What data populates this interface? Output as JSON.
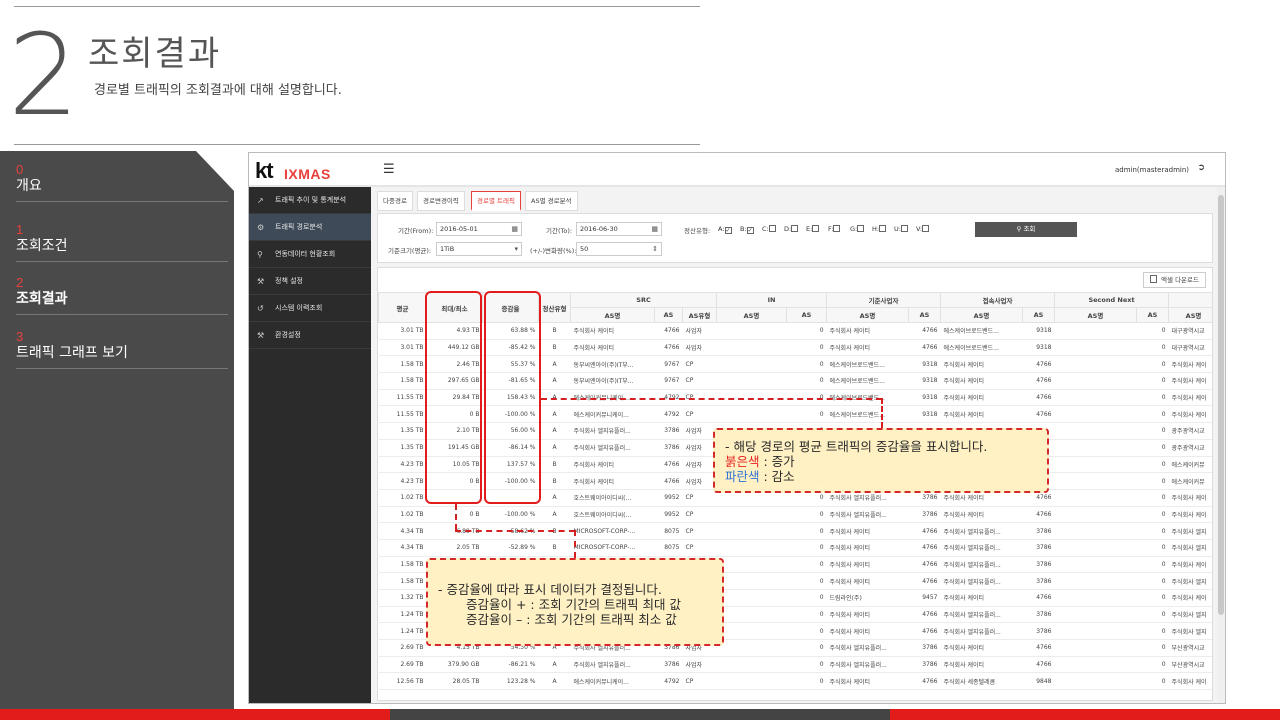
{
  "slide": {
    "number": "2",
    "title": "조회결과",
    "subtitle": "경로별 트래픽의 조회결과에 대해 설명합니다."
  },
  "left_menu": [
    {
      "num": "0",
      "label": "개요"
    },
    {
      "num": "1",
      "label": "조회조건"
    },
    {
      "num": "2",
      "label": "조회결과"
    },
    {
      "num": "3",
      "label": "트래픽 그래프 보기"
    }
  ],
  "colors": {
    "accent": "#e8413c",
    "menu_bg": "#4a4a4a",
    "bottom_dark": "#444444"
  },
  "app": {
    "logo_kt": "kt",
    "logo_brand": "IXMAS",
    "user": "admin(masteradmin)",
    "side_menu": [
      {
        "icon": "chart-line-icon",
        "label": "트래픽 추이 및 통계분석"
      },
      {
        "icon": "gauge-icon",
        "label": "트래픽 경로분석"
      },
      {
        "icon": "search-icon",
        "label": "연동데이터 현황조회"
      },
      {
        "icon": "wrench-icon",
        "label": "정책 설정"
      },
      {
        "icon": "history-icon",
        "label": "시스템 이력조회"
      },
      {
        "icon": "wrench-icon",
        "label": "환경설정"
      }
    ],
    "tabs": [
      "다중경로",
      "경로변경이력",
      "경로별 트래픽",
      "AS별 경로분석"
    ],
    "filters": {
      "from_label": "기간(From):",
      "from_value": "2016-05-01",
      "to_label": "기간(To):",
      "to_value": "2016-06-30",
      "type_label": "정산유형:",
      "types": [
        {
          "label": "A:",
          "checked": true
        },
        {
          "label": "B:",
          "checked": true
        },
        {
          "label": "C:",
          "checked": false
        },
        {
          "label": "D:",
          "checked": false
        },
        {
          "label": "E:",
          "checked": false
        },
        {
          "label": "F:",
          "checked": false
        },
        {
          "label": "G:",
          "checked": false
        },
        {
          "label": "H:",
          "checked": false
        },
        {
          "label": "U:",
          "checked": false
        },
        {
          "label": "V:",
          "checked": false
        }
      ],
      "search_label": "조회",
      "size_label": "기준크기(평균):",
      "size_value": "1TiB",
      "change_label": "(+/-)변화량(%):",
      "change_value": "50"
    },
    "excel_label": "엑셀 다운로드",
    "table": {
      "group_headers": [
        "평균",
        "최대/최소",
        "증감율",
        "정산유형",
        "SRC",
        "IN",
        "기준사업자",
        "접속사업자",
        "Second Next",
        ""
      ],
      "sub_headers": [
        "AS명",
        "AS",
        "AS유형",
        "AS명",
        "AS",
        "AS명",
        "AS",
        "AS명",
        "AS",
        "AS명",
        "AS",
        "AS명"
      ],
      "rows": [
        [
          "3.01 TB",
          "4.93 TB",
          "63.88 %",
          "B",
          "주식회사 케이티",
          "4766",
          "사업자",
          "",
          "0",
          "주식회사 케이티",
          "4766",
          "에스케이브로드밴드...",
          "9318",
          "",
          "0",
          "대구광역시교"
        ],
        [
          "3.01 TB",
          "449.12 GB",
          "-85.42 %",
          "B",
          "주식회사 케이티",
          "4766",
          "사업자",
          "",
          "0",
          "주식회사 케이티",
          "4766",
          "에스케이브로드밴드...",
          "9318",
          "",
          "0",
          "대구광역시교"
        ],
        [
          "1.58 TB",
          "2.46 TB",
          "55.37 %",
          "A",
          "동부씨엔아이(주)IT부...",
          "9767",
          "CP",
          "",
          "0",
          "에스케이브로드밴드...",
          "9318",
          "주식회사 케이티",
          "4766",
          "",
          "0",
          "주식회사 케이"
        ],
        [
          "1.58 TB",
          "297.65 GB",
          "-81.65 %",
          "A",
          "동부씨엔아이(주)IT부...",
          "9767",
          "CP",
          "",
          "0",
          "에스케이브로드밴드...",
          "9318",
          "주식회사 케이티",
          "4766",
          "",
          "0",
          "주식회사 케이"
        ],
        [
          "11.55 TB",
          "29.84 TB",
          "158.43 %",
          "A",
          "에스케이커뮤니케이...",
          "4792",
          "CP",
          "",
          "0",
          "에스케이브로드밴드...",
          "9318",
          "주식회사 케이티",
          "4766",
          "",
          "0",
          "주식회사 케이"
        ],
        [
          "11.55 TB",
          "0 B",
          "-100.00 %",
          "A",
          "에스케이커뮤니케이...",
          "4792",
          "CP",
          "",
          "0",
          "에스케이브로드밴드...",
          "9318",
          "주식회사 케이티",
          "4766",
          "",
          "0",
          "주식회사 케이"
        ],
        [
          "1.35 TB",
          "2.10 TB",
          "56.00 %",
          "A",
          "주식회사 엘지유플러...",
          "3786",
          "사업자",
          "",
          "0",
          "",
          "",
          "",
          "",
          "",
          "0",
          "광주광역시교"
        ],
        [
          "1.35 TB",
          "191.45 GB",
          "-86.14 %",
          "A",
          "주식회사 엘지유플러...",
          "3786",
          "사업자",
          "",
          "0",
          "",
          "",
          "",
          "",
          "",
          "0",
          "광주광역시교"
        ],
        [
          "4.23 TB",
          "10.05 TB",
          "137.57 %",
          "B",
          "주식회사 케이티",
          "4766",
          "사업자",
          "",
          "0",
          "",
          "",
          "",
          "",
          "",
          "0",
          "에스케이커뮤"
        ],
        [
          "4.23 TB",
          "0 B",
          "-100.00 %",
          "B",
          "주식회사 케이티",
          "4766",
          "사업자",
          "",
          "0",
          "",
          "",
          "",
          "",
          "",
          "0",
          "에스케이커뮤"
        ],
        [
          "1.02 TB",
          "",
          "",
          "A",
          "호스트웨이아이디씨(...",
          "9952",
          "CP",
          "",
          "0",
          "주식회사 엘지유플러...",
          "3786",
          "주식회사 케이티",
          "4766",
          "",
          "0",
          "주식회사 케이"
        ],
        [
          "1.02 TB",
          "0 B",
          "-100.00 %",
          "A",
          "호스트웨이아이디씨(...",
          "9952",
          "CP",
          "",
          "0",
          "주식회사 엘지유플러...",
          "3786",
          "주식회사 케이티",
          "4766",
          "",
          "0",
          "주식회사 케이"
        ],
        [
          "4.34 TB",
          "6.89 TB",
          "58.62 %",
          "B",
          "MICROSOFT-CORP-...",
          "8075",
          "CP",
          "",
          "0",
          "주식회사 케이티",
          "4766",
          "주식회사 엘지유플러...",
          "3786",
          "",
          "0",
          "주식회사 엘지"
        ],
        [
          "4.34 TB",
          "2.05 TB",
          "-52.89 %",
          "B",
          "MICROSOFT-CORP-...",
          "8075",
          "CP",
          "",
          "0",
          "주식회사 케이티",
          "4766",
          "주식회사 엘지유플러...",
          "3786",
          "",
          "0",
          "주식회사 엘지"
        ],
        [
          "1.58 TB",
          "",
          "",
          "",
          "",
          "",
          "",
          "",
          "0",
          "주식회사 케이티",
          "4766",
          "주식회사 엘지유플러...",
          "3786",
          "",
          "0",
          "주식회사 케이"
        ],
        [
          "1.58 TB",
          "",
          "",
          "",
          "",
          "",
          "",
          "",
          "0",
          "주식회사 케이티",
          "4766",
          "주식회사 엘지유플러...",
          "3786",
          "",
          "0",
          "주식회사 엘지"
        ],
        [
          "1.32 TB",
          "",
          "",
          "",
          "",
          "",
          "",
          "",
          "0",
          "드림라인(주)",
          "9457",
          "주식회사 케이티",
          "4766",
          "",
          "0",
          "주식회사 케이"
        ],
        [
          "1.24 TB",
          "",
          "",
          "",
          "",
          "",
          "",
          "",
          "0",
          "주식회사 케이티",
          "4766",
          "주식회사 엘지유플러...",
          "3786",
          "",
          "0",
          "주식회사 엘지"
        ],
        [
          "1.24 TB",
          "",
          "",
          "",
          "",
          "",
          "",
          "",
          "0",
          "주식회사 케이티",
          "4766",
          "주식회사 엘지유플러...",
          "3786",
          "",
          "0",
          "주식회사 엘지"
        ],
        [
          "2.69 TB",
          "4.15 TB",
          "54.30 %",
          "A",
          "주식회사 엘지유플러...",
          "3786",
          "사업자",
          "",
          "0",
          "주식회사 엘지유플러...",
          "3786",
          "주식회사 케이티",
          "4766",
          "",
          "0",
          "부산광역시교"
        ],
        [
          "2.69 TB",
          "379.90 GB",
          "-86.21 %",
          "A",
          "주식회사 엘지유플러...",
          "3786",
          "사업자",
          "",
          "0",
          "주식회사 엘지유플러...",
          "3786",
          "주식회사 케이티",
          "4766",
          "",
          "0",
          "부산광역시교"
        ],
        [
          "12.56 TB",
          "28.05 TB",
          "123.28 %",
          "A",
          "에스케이커뮤니케이...",
          "4792",
          "CP",
          "",
          "0",
          "주식회사 케이티",
          "4766",
          "주식회사 세종텔레콤",
          "9848",
          "",
          "0",
          "주식회사 케이"
        ]
      ]
    }
  },
  "callout1": {
    "line1": "-   해당 경로의 평균 트래픽의 증감율을 표시합니다.",
    "red_label": "붉은색",
    "red_text": " : 증가",
    "blue_label": "파란색",
    "blue_text": " : 감소"
  },
  "callout2": {
    "line1": "-   증감율에 따라 표시 데이터가 결정됩니다.",
    "line2": "증감율이 + : 조회 기간의 트래픽 최대 값",
    "line3": "증감율이 – : 조회 기간의 트래픽 최소 값"
  }
}
